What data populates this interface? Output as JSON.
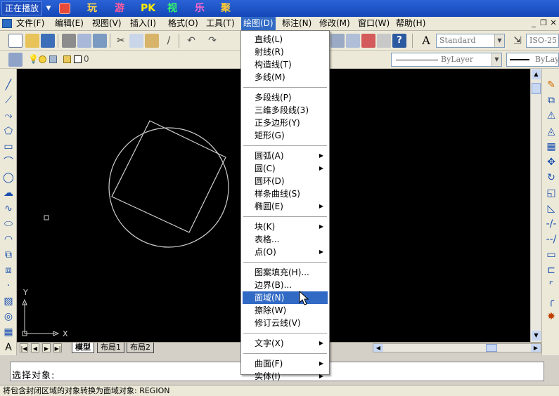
{
  "topbar": {
    "playing_label": "正在播放",
    "tabs": [
      {
        "label": "玩",
        "color": "#ffd34a"
      },
      {
        "label": "游",
        "color": "#ff5a9e"
      },
      {
        "label": "PK",
        "color": "#ffee00"
      },
      {
        "label": "视",
        "color": "#33ff66"
      },
      {
        "label": "乐",
        "color": "#ff66cc"
      },
      {
        "label": "聚",
        "color": "#ffcc33"
      }
    ]
  },
  "menubar": {
    "items": [
      {
        "label": "文件(F)"
      },
      {
        "label": "编辑(E)"
      },
      {
        "label": "视图(V)"
      },
      {
        "label": "插入(I)"
      },
      {
        "label": "格式(O)"
      },
      {
        "label": "工具(T)"
      },
      {
        "label": "绘图(D)"
      },
      {
        "label": "标注(N)"
      },
      {
        "label": "修改(M)"
      },
      {
        "label": "窗口(W)"
      },
      {
        "label": "帮助(H)"
      }
    ],
    "active_item": "绘图(D)"
  },
  "toolbar": {
    "text_style": "Standard",
    "dim_style": "ISO-25",
    "layer_name": "0",
    "linetype": "ByLayer",
    "lineweight": "ByLay"
  },
  "dropdown": {
    "groups": [
      [
        {
          "label": "直线(L)"
        },
        {
          "label": "射线(R)"
        },
        {
          "label": "构造线(T)"
        },
        {
          "label": "多线(M)"
        }
      ],
      [
        {
          "label": "多段线(P)"
        },
        {
          "label": "三维多段线(3)"
        },
        {
          "label": "正多边形(Y)"
        },
        {
          "label": "矩形(G)"
        }
      ],
      [
        {
          "label": "圆弧(A)",
          "submenu": true
        },
        {
          "label": "圆(C)",
          "submenu": true
        },
        {
          "label": "圆环(D)"
        },
        {
          "label": "样条曲线(S)"
        },
        {
          "label": "椭圆(E)",
          "submenu": true
        }
      ],
      [
        {
          "label": "块(K)",
          "submenu": true
        },
        {
          "label": "表格..."
        },
        {
          "label": "点(O)",
          "submenu": true
        }
      ],
      [
        {
          "label": "图案填充(H)..."
        },
        {
          "label": "边界(B)..."
        },
        {
          "label": "面域(N)",
          "highlighted": true
        },
        {
          "label": "擦除(W)"
        },
        {
          "label": "修订云线(V)"
        }
      ],
      [
        {
          "label": "文字(X)",
          "submenu": true
        }
      ],
      [
        {
          "label": "曲面(F)",
          "submenu": true
        },
        {
          "label": "实体(I)",
          "submenu": true
        }
      ]
    ]
  },
  "canvas": {
    "ucs_x_label": "X",
    "ucs_y_label": "Y"
  },
  "layout_tabs": [
    {
      "label": "模型",
      "active": true
    },
    {
      "label": "布局1",
      "active": false
    },
    {
      "label": "布局2",
      "active": false
    }
  ],
  "command_line": {
    "prompt": "选择对象:"
  },
  "status_text": "将包含封闭区域的对象转换为面域对象:  REGION"
}
